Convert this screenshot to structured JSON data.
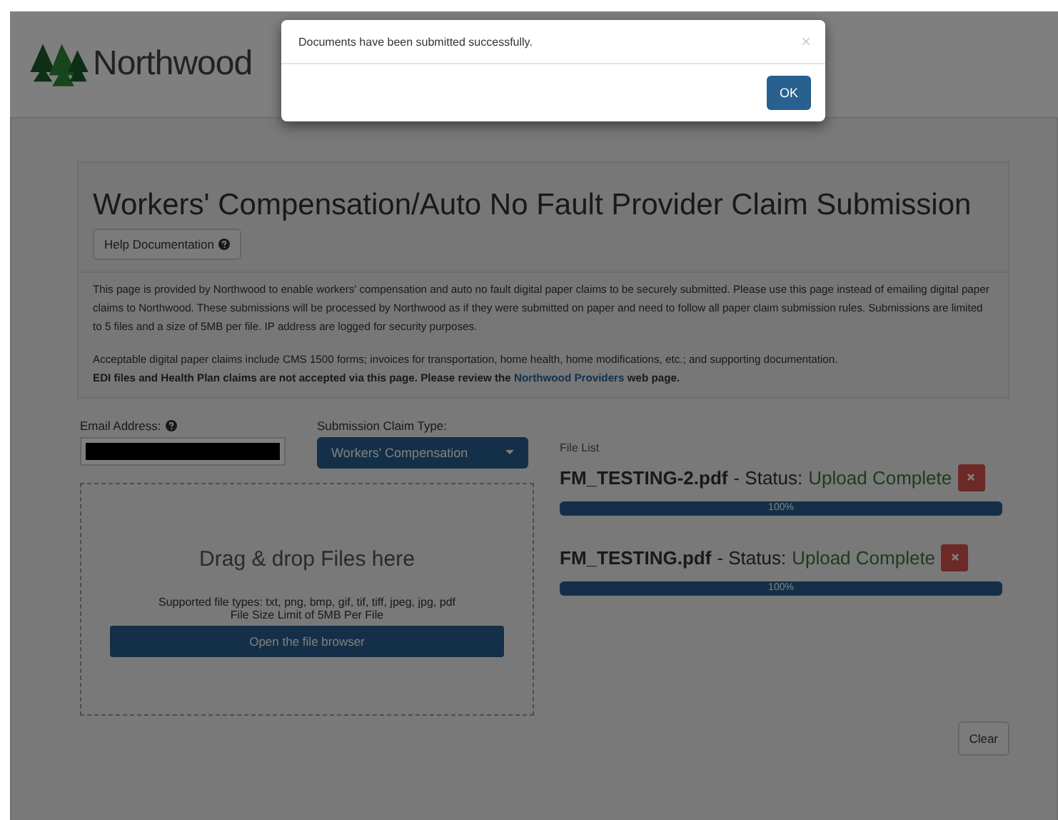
{
  "logo": {
    "text": "Northwood"
  },
  "page": {
    "title": "Workers' Compensation/Auto No Fault Provider Claim Submission",
    "help_button": "Help Documentation",
    "intro": [
      "This page is provided by Northwood to enable workers' compensation and auto no fault digital paper claims to be securely submitted. Please use this page instead of emailing digital paper claims to Northwood. These submissions will be processed by Northwood as if they were submitted on paper and need to follow all paper claim submission rules. Submissions are limited to 5 files and a size of 5MB per file. IP address are logged for security purposes.",
      "Acceptable digital paper claims include CMS 1500 forms; invoices for transportation, home health, home modifications, etc.; and supporting documentation."
    ],
    "notice": {
      "before": "EDI files and Health Plan claims are not accepted via this page. Please review the",
      "link": "Northwood Providers",
      "after": "web page."
    }
  },
  "form": {
    "email_label": "Email Address:",
    "email_redacted": true,
    "claim_type_label": "Submission Claim Type:",
    "claim_type": "Workers' Compensation"
  },
  "dropzone": {
    "title": "Drag & drop Files here",
    "types": "Supported file types: txt, png, bmp, gif, tif, tiff, jpeg, jpg, pdf",
    "limit": "File Size Limit of 5MB Per File",
    "button": "Open the file browser"
  },
  "file_list": {
    "label": "File List",
    "files": [
      {
        "name": "FM_TESTING-2.pdf",
        "status_label": "- Status:",
        "status": "Upload Complete",
        "level": 1,
        "reading": "100%"
      },
      {
        "name": "FM_TESTING.pdf",
        "status_label": "- Status:",
        "status": "Upload Complete",
        "level": 1,
        "reading": "100%"
      }
    ]
  },
  "clear_button": "Clear",
  "modal": {
    "message": "Documents have been submitted successfully.",
    "close": "×",
    "ok": "OK"
  }
}
